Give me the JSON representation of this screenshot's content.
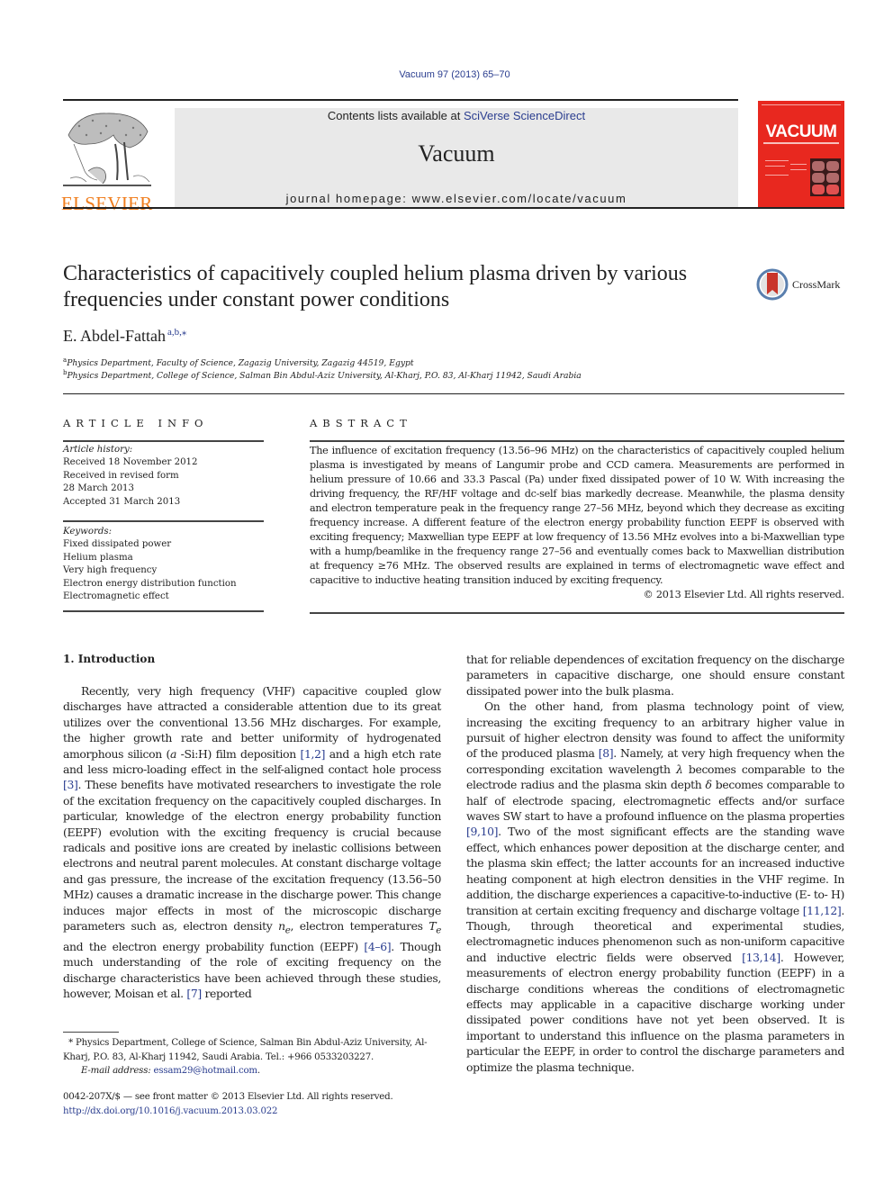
{
  "header": {
    "citation": "Vacuum 97 (2013) 65–70",
    "contents_prefix": "Contents lists available at ",
    "contents_link": "SciVerse ScienceDirect",
    "journal_name": "Vacuum",
    "homepage": "journal homepage: www.elsevier.com/locate/vacuum",
    "publisher_logo": "ELSEVIER",
    "cover_title": "VACUUM",
    "colors": {
      "publisher_orange": "#f07e1e",
      "cover_red": "#e8281f",
      "link_blue": "#2a3d8f",
      "banner_gray": "#e9e9e9"
    }
  },
  "article": {
    "title": "Characteristics of capacitively coupled helium plasma driven by various frequencies under constant power conditions",
    "crossmark_label": "CrossMark",
    "author": "E. Abdel-Fattah",
    "author_marks": "a,b,⁎",
    "affiliations": [
      {
        "mark": "a",
        "text": "Physics Department, Faculty of Science, Zagazig University, Zagazig 44519, Egypt"
      },
      {
        "mark": "b",
        "text": "Physics Department, College of Science, Salman Bin Abdul-Aziz University, Al-Kharj, P.O. 83, Al-Kharj 11942, Saudi Arabia"
      }
    ]
  },
  "article_info": {
    "heading": "ARTICLE INFO",
    "history_caption": "Article history:",
    "history": [
      "Received 18 November 2012",
      "Received in revised form",
      "28 March 2013",
      "Accepted 31 March 2013"
    ],
    "keywords_caption": "Keywords:",
    "keywords": [
      "Fixed dissipated power",
      "Helium plasma",
      "Very high frequency",
      "Electron energy distribution function",
      "Electromagnetic effect"
    ]
  },
  "abstract": {
    "heading": "ABSTRACT",
    "text": "The influence of excitation frequency (13.56–96 MHz) on the characteristics of capacitively coupled helium plasma is investigated by means of Langumir probe and CCD camera. Measurements are performed in helium pressure of 10.66 and 33.3 Pascal (Pa) under fixed dissipated power of 10 W. With increasing the driving frequency, the RF/HF voltage and dc-self bias markedly decrease. Meanwhile, the plasma density and electron temperature peak in the frequency range 27–56 MHz, beyond which they decrease as exciting frequency increase. A different feature of the electron energy probability function EEPF is observed with exciting frequency; Maxwellian type EEPF at low frequency of 13.56 MHz evolves into a bi-Maxwellian type with a hump/beamlike in the frequency range 27–56 and eventually comes back to Maxwellian distribution at frequency ≥76 MHz. The observed results are explained in terms of electromagnetic wave effect and capacitive to inductive heating transition induced by exciting frequency.",
    "copyright": "© 2013 Elsevier Ltd. All rights reserved."
  },
  "introduction": {
    "heading": "1.  Introduction",
    "left_p1": {
      "t1": "Recently, very high frequency (VHF) capacitive coupled glow discharges have attracted a considerable attention due to its great utilizes over the conventional 13.56 MHz discharges. For example, the higher growth rate and better uniformity of hydrogenated amorphous silicon (",
      "t1_italic": "a",
      "t2": " -Si:H) film deposition ",
      "ref1": "[1,2]",
      "t3": " and a high etch rate and less micro-loading effect in the self-aligned contact hole process ",
      "ref2": "[3]",
      "t4": ". These benefits have motivated researchers to investigate the role of the excitation frequency on the capacitively coupled discharges. In particular, knowledge of the electron energy probability function (EEPF) evolution with the exciting frequency is crucial because radicals and positive ions are created by inelastic collisions between electrons and neutral parent molecules. At constant discharge voltage and gas pressure, the increase of the excitation frequency (13.56–50 MHz) causes a dramatic increase in the discharge power. This change induces major effects in most of the microscopic discharge parameters such as, electron density ",
      "ne": "n",
      "ne_sub": "e",
      "t5": ", electron temperatures ",
      "te": "T",
      "te_sub": "e",
      "t6": " and the electron energy probability function (EEPF) ",
      "ref3": "[4–6]",
      "t7": ". Though much understanding of the role of exciting frequency on the discharge characteristics have been achieved through these studies, however, Moisan et al. ",
      "ref4": "[7]",
      "t8": " reported"
    },
    "right_p1": "that for reliable dependences of excitation frequency on the discharge parameters in capacitive discharge, one should ensure constant dissipated power into the bulk plasma.",
    "right_p2": {
      "t1": "On the other hand, from plasma technology point of view, increasing the exciting frequency to an arbitrary higher value in pursuit of higher electron density was found to affect the uniformity of the produced plasma ",
      "ref1": "[8]",
      "t2": ". Namely, at very high frequency when the corresponding excitation wavelength ",
      "lambda": "λ",
      "t3": " becomes comparable to the electrode radius and the plasma skin depth ",
      "delta": "δ",
      "t4": " becomes comparable to half of electrode spacing, electromagnetic effects and/or surface waves SW start to have a profound influence on the plasma properties ",
      "ref2": "[9,10]",
      "t5": ". Two of the most significant effects are the standing wave effect, which enhances power deposition at the discharge center, and the plasma skin effect; the latter accounts for an increased inductive heating component at high electron densities in the VHF regime. In addition, the discharge experiences a capacitive-to-inductive (E- to- H) transition at certain exciting frequency and discharge voltage ",
      "ref3": "[11,12]",
      "t6": ". Though, through theoretical and experimental studies, electromagnetic induces phenomenon such as non-uniform capacitive and inductive electric fields were observed ",
      "ref4": "[13,14]",
      "t7": ". However, measurements of electron energy probability function (EEPF) in a discharge conditions whereas the conditions of electromagnetic effects may applicable in a capacitive discharge working under dissipated power conditions have not yet been observed. It is important to understand this influence on the plasma parameters in particular the EEPF, in order to control the discharge parameters and optimize the plasma technique."
    }
  },
  "footnote": {
    "mark": "*",
    "text": " Physics Department, College of Science, Salman Bin Abdul-Aziz University, Al-Kharj, P.O. 83, Al-Kharj 11942, Saudi Arabia. Tel.: +966 0533203227.",
    "email_caption": "E-mail address: ",
    "email": "essam29@hotmail.com",
    "email_suffix": "."
  },
  "front_matter": {
    "issn_line": "0042-207X/$ — see front matter © 2013 Elsevier Ltd. All rights reserved.",
    "doi": "http://dx.doi.org/10.1016/j.vacuum.2013.03.022"
  }
}
